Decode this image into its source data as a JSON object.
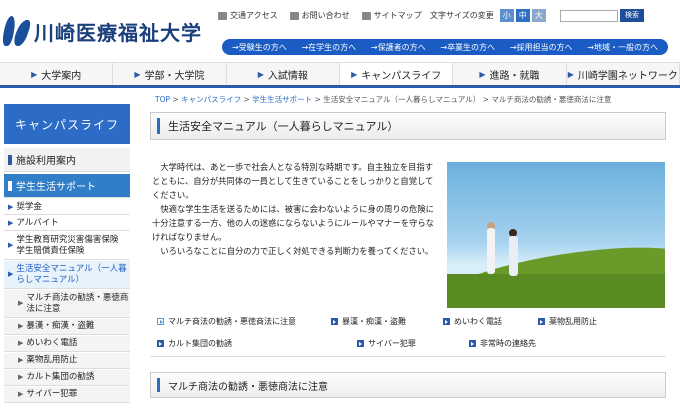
{
  "logo": {
    "text": "川崎医療福祉大学"
  },
  "utility": {
    "access": "交通アクセス",
    "contact": "お問い合わせ",
    "sitemap": "サイトマップ",
    "font_size_label": "文字サイズの変更",
    "font_small": "小",
    "font_medium": "中",
    "font_large": "大",
    "search_placeholder": "",
    "search_button": "検索"
  },
  "audience": [
    "→受験生の方へ",
    "→在学生の方へ",
    "→保護者の方へ",
    "→卒業生の方へ",
    "→採用担当の方へ",
    "→地域・一般の方へ"
  ],
  "gnav": [
    "大学案内",
    "学部・大学院",
    "入試情報",
    "キャンパスライフ",
    "進路・就職",
    "川崎学園ネットワーク"
  ],
  "sidebar": {
    "title": "キャンパスライフ",
    "items": [
      "施設利用案内",
      "学生生活サポート",
      "奨学金",
      "アルバイト",
      "学生教育研究災害傷害保険　学生賠償責任保険",
      "生活安全マニュアル（一人暮らしマニュアル）",
      "マルチ商法の勧誘・悪徳商法に注意",
      "暴漢・痴漢・盗難",
      "めいわく電話",
      "薬物乱用防止",
      "カルト集団の勧誘",
      "サイバー犯罪"
    ]
  },
  "breadcrumb": {
    "top": "TOP",
    "sep": " > ",
    "campus": "キャンパスライフ",
    "support": "学生生活サポート",
    "manual": "生活安全マニュアル（一人暮らしマニュアル）",
    "current": "マルチ商法の勧誘・悪徳商法に注意"
  },
  "page": {
    "title": "生活安全マニュアル（一人暮らしマニュアル）",
    "paragraphs": [
      "大学時代は、あと一歩で社会人となる特別な時期です。自主独立を目指すとともに、自分が共同体の一員として生きていることをしっかりと自覚してください。",
      "快適な学生生活を送るためには、被害に会わないように身の周りの危険に十分注意する一方、他の人の迷惑にならないようにルールやマナーを守らなければなりません。",
      "いろいろなことに自分の力で正しく対処できる判断力を養ってください。"
    ],
    "links": [
      "マルチ商法の勧誘・悪徳商法に注意",
      "暴漢・痴漢・盗難",
      "めいわく電話",
      "薬物乱用防止",
      "カルト集団の勧誘",
      "サイバー犯罪",
      "非常時の連絡先"
    ],
    "section_title": "マルチ商法の勧誘・悪徳商法に注意"
  }
}
